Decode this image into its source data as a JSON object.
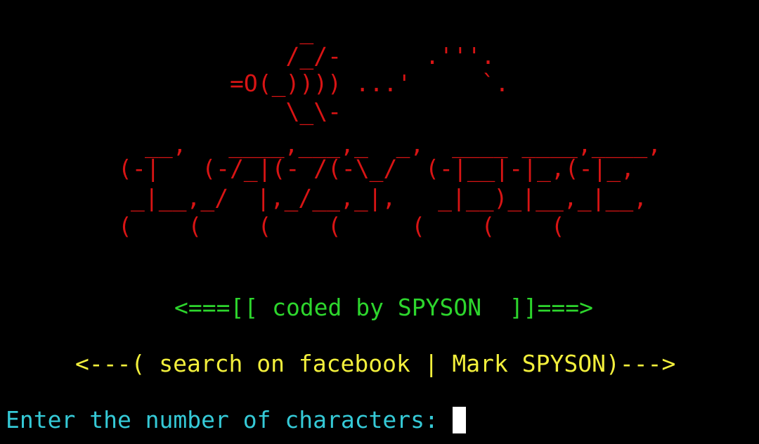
{
  "colors": {
    "background": "#000000",
    "banner": "#d81414",
    "credit": "#2dd62d",
    "facebook": "#f2ef3c",
    "prompt": "#35c9d6",
    "cursor": "#ffffff"
  },
  "banner": {
    "lines": [
      "     _",
      "    /_/-      .'''.",
      "=O(_)))) ...'     `.",
      "    \\_\\-",
      "__,   ____,___,_  _,  ____ ____,____,",
      "(-|   (-/_|(- /(-\\_/  (-|__|-|_,(-|_,",
      "_|__,_/  |,_/__,_|,   _|__)_|__,_|__,",
      "(    (    (    (     (    (    ("
    ]
  },
  "credit": "<===[[ coded by SPYSON  ]]===>",
  "facebook": "<---( search on facebook | Mark SPYSON)--->",
  "prompt": {
    "label": "Enter the number of characters: ",
    "cursor_icon": "block-cursor"
  }
}
